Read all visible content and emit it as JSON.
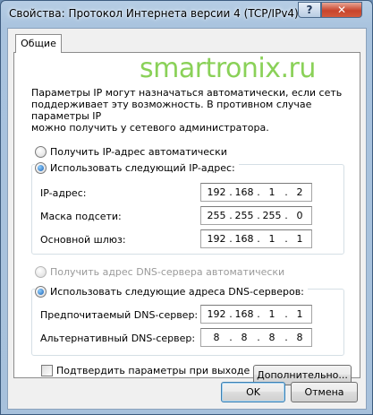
{
  "window": {
    "title": "Свойства: Протокол Интернета версии 4 (TCP/IPv4)",
    "help_label": "?",
    "close_label": "✕"
  },
  "tabs": {
    "general": "Общие"
  },
  "watermark": "smartronix.ru",
  "intro_text": "Параметры IP могут назначаться автоматически, если сеть\nподдерживает эту возможность. В противном случае параметры IP\nможно получить у сетевого администратора.",
  "ip": {
    "auto_label": "Получить IP-адрес автоматически",
    "manual_label": "Использовать следующий IP-адрес:",
    "selected": "manual",
    "fields": [
      {
        "label": "IP-адрес:",
        "octets": [
          "192",
          "168",
          "1",
          "2"
        ]
      },
      {
        "label": "Маска подсети:",
        "octets": [
          "255",
          "255",
          "255",
          "0"
        ]
      },
      {
        "label": "Основной шлюз:",
        "octets": [
          "192",
          "168",
          "1",
          "1"
        ]
      }
    ]
  },
  "dns": {
    "auto_label": "Получить адрес DNS-сервера автоматически",
    "manual_label": "Использовать следующие адреса DNS-серверов:",
    "selected": "manual",
    "fields": [
      {
        "label": "Предпочитаемый DNS-сервер:",
        "octets": [
          "192",
          "168",
          "1",
          "1"
        ]
      },
      {
        "label": "Альтернативный DNS-сервер:",
        "octets": [
          "8",
          "8",
          "8",
          "8"
        ]
      }
    ]
  },
  "validate_checkbox": {
    "label": "Подтвердить параметры при выходе",
    "checked": false
  },
  "buttons": {
    "advanced": "Дополнительно...",
    "ok": "OK",
    "cancel": "Отмена"
  },
  "colors": {
    "watermark": "#8ad158",
    "frame": "#a9c3de",
    "close": "#c8442c"
  }
}
